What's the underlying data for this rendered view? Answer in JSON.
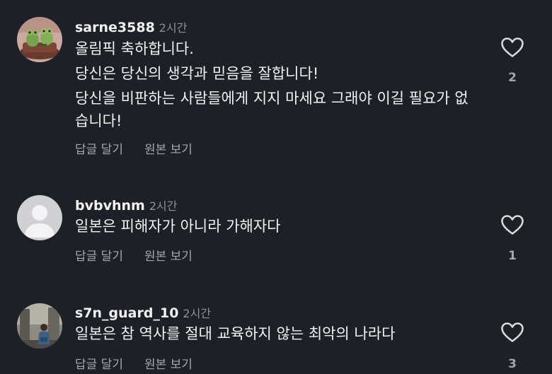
{
  "comments": [
    {
      "username": "sarne3588",
      "time": "2시간",
      "lines": [
        "올림픽 축하합니다.",
        "당신은 당신의 생각과 믿음을 잘합니다!",
        "당신을 비판하는 사람들에게 지지 마세요 그래야 이길 필요가 없습니다!"
      ],
      "reply_label": "답글 달기",
      "view_original_label": "원본 보기",
      "likes": "2",
      "avatar_icon": "frog-figurine-avatar"
    },
    {
      "username": "bvbvhnm",
      "time": "2시간",
      "lines": [
        "일본은 피해자가 아니라 가해자다"
      ],
      "reply_label": "답글 달기",
      "view_original_label": "원본 보기",
      "likes": "1",
      "avatar_icon": "default-person-avatar"
    },
    {
      "username": "s7n_guard_10",
      "time": "2시간",
      "lines": [
        "일본은 참 역사를 절대 교육하지 않는 최악의 나라다"
      ],
      "reply_label": "답글 달기",
      "view_original_label": "원본 보기",
      "likes": "3",
      "avatar_icon": "photo-avatar"
    }
  ],
  "colors": {
    "background": "#1d2026",
    "text": "#f2f2f4",
    "muted": "#8e9098",
    "action": "#a4a6ad",
    "heart_outline": "#d9d9dc"
  }
}
